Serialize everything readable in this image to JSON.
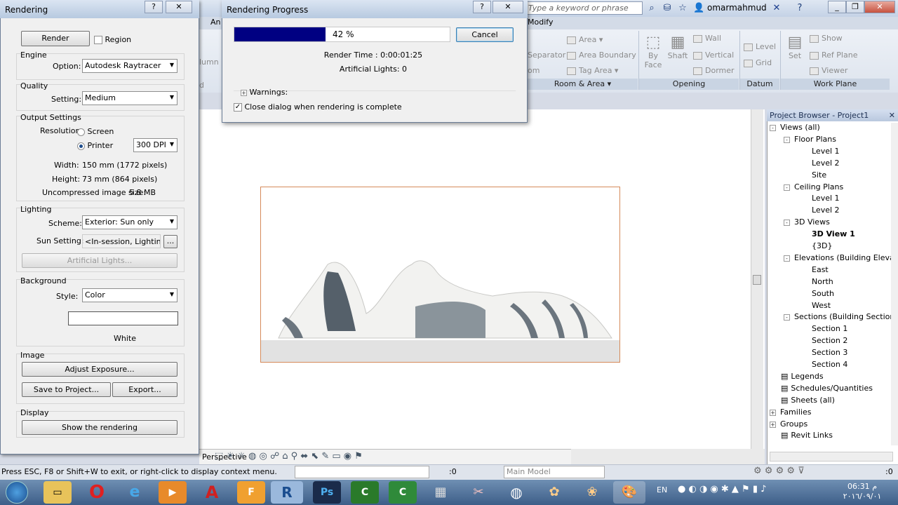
{
  "topbar": {
    "search_placeholder": "Type a keyword or phrase",
    "user": "omarmahmud"
  },
  "ribbon": {
    "tabs": [
      "An",
      "Modify"
    ],
    "items": {
      "area": "Area",
      "area_boundary": "Area Boundary",
      "tag_area": "Tag Area",
      "separator": "Separator",
      "om": "om",
      "lumn": "lumn",
      "d": "d",
      "by_face": "By Face",
      "shaft": "Shaft",
      "wall": "Wall",
      "vertical": "Vertical",
      "dormer": "Dormer",
      "level": "Level",
      "grid": "Grid",
      "set": "Set",
      "show": "Show",
      "ref_plane": "Ref Plane",
      "viewer": "Viewer"
    },
    "panels": {
      "room_area": "Room & Area",
      "opening": "Opening",
      "datum": "Datum",
      "work_plane": "Work Plane"
    }
  },
  "rendering": {
    "title": "Rendering",
    "render_btn": "Render",
    "region": "Region",
    "engine_group": "Engine",
    "option_label": "Option:",
    "option_value": "Autodesk Raytracer",
    "quality_group": "Quality",
    "setting_label": "Setting:",
    "setting_value": "Medium",
    "output_group": "Output Settings",
    "resolution_label": "Resolution:",
    "screen": "Screen",
    "printer": "Printer",
    "dpi": "300 DPI",
    "width_label": "Width:",
    "width_value": "150 mm (1772 pixels)",
    "height_label": "Height:",
    "height_value": "73 mm (864 pixels)",
    "size_label": "Uncompressed image size:",
    "size_value": "5.8 MB",
    "lighting_group": "Lighting",
    "scheme_label": "Scheme:",
    "scheme_value": "Exterior: Sun only",
    "sun_label": "Sun Setting:",
    "sun_value": "<In-session, Lighting>",
    "sun_btn": "...",
    "artificial_btn": "Artificial Lights...",
    "background_group": "Background",
    "style_label": "Style:",
    "style_value": "Color",
    "color_name": "White",
    "image_group": "Image",
    "adjust_btn": "Adjust Exposure...",
    "save_btn": "Save to Project...",
    "export_btn": "Export...",
    "display_group": "Display",
    "show_btn": "Show the rendering"
  },
  "progress": {
    "title": "Rendering Progress",
    "percent": "42 %",
    "percent_value": 42,
    "cancel": "Cancel",
    "render_time": "Render Time : 0:00:01:25",
    "artificial": "Artificial Lights: 0",
    "warnings": "Warnings:",
    "close_label": "Close dialog when rendering is complete"
  },
  "browser": {
    "title": "Project Browser - Project1",
    "items": [
      {
        "label": "Views (all)",
        "level": 0,
        "box": "-"
      },
      {
        "label": "Floor Plans",
        "level": 1,
        "box": "-"
      },
      {
        "label": "Level 1",
        "level": 2
      },
      {
        "label": "Level 2",
        "level": 2
      },
      {
        "label": "Site",
        "level": 2
      },
      {
        "label": "Ceiling Plans",
        "level": 1,
        "box": "-"
      },
      {
        "label": "Level 1",
        "level": 2
      },
      {
        "label": "Level 2",
        "level": 2
      },
      {
        "label": "3D Views",
        "level": 1,
        "box": "-"
      },
      {
        "label": "3D View 1",
        "level": 2,
        "bold": true
      },
      {
        "label": "{3D}",
        "level": 2
      },
      {
        "label": "Elevations (Building Elevation)",
        "level": 1,
        "box": "-"
      },
      {
        "label": "East",
        "level": 2
      },
      {
        "label": "North",
        "level": 2
      },
      {
        "label": "South",
        "level": 2
      },
      {
        "label": "West",
        "level": 2
      },
      {
        "label": "Sections (Building Section)",
        "level": 1,
        "box": "-"
      },
      {
        "label": "Section 1",
        "level": 2
      },
      {
        "label": "Section 2",
        "level": 2
      },
      {
        "label": "Section 3",
        "level": 2
      },
      {
        "label": "Section 4",
        "level": 2
      },
      {
        "label": "Legends",
        "level": 0
      },
      {
        "label": "Schedules/Quantities",
        "level": 0
      },
      {
        "label": "Sheets (all)",
        "level": 0
      },
      {
        "label": "Families",
        "level": 0,
        "box": "+"
      },
      {
        "label": "Groups",
        "level": 0,
        "box": "+"
      },
      {
        "label": "Revit Links",
        "level": 0
      }
    ]
  },
  "viewctl": {
    "perspective": "Perspective"
  },
  "status": {
    "text": "Press ESC, F8 or Shift+W to exit, or right-click to display context menu.",
    "zero1": ":0",
    "model": "Main Model",
    "zero2": ":0"
  },
  "taskbar": {
    "lang": "EN",
    "time": "06:31 م",
    "date": "٢٠١٦/٠٩/٠١"
  }
}
